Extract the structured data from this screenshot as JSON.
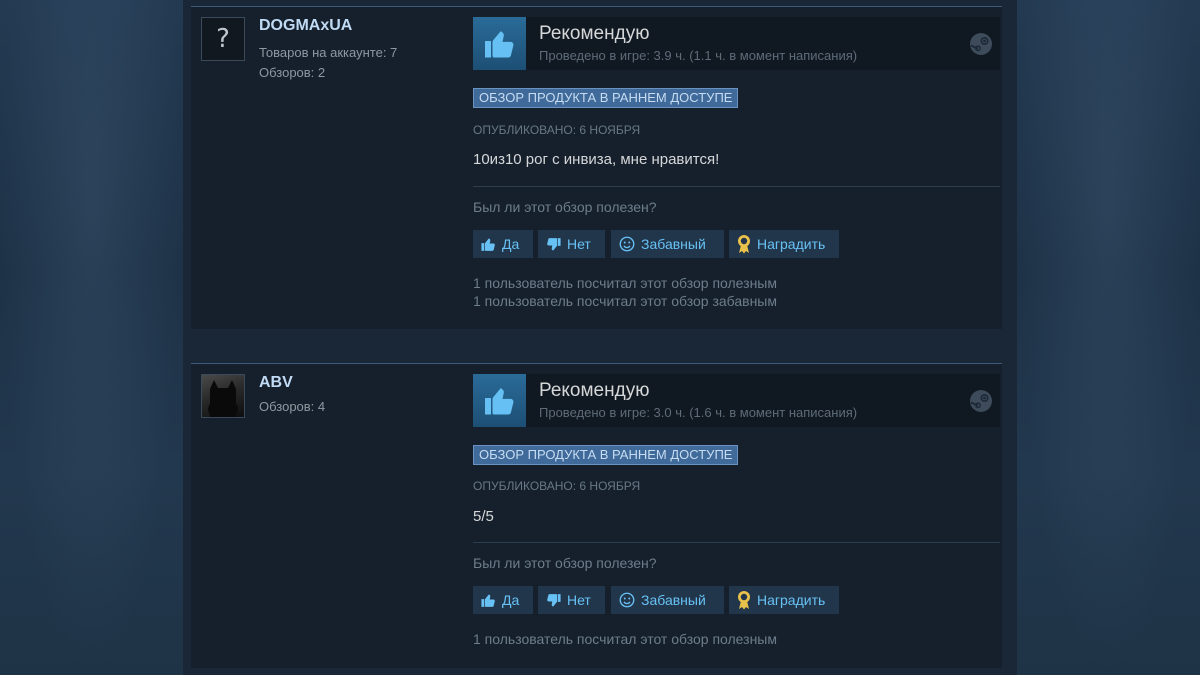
{
  "colors": {
    "page_bg": "#1b2838",
    "card_bg": "#16202d",
    "accent_link": "#67c1f5",
    "author_name": "#c1dbf4",
    "badge_bg": "#3f6a99",
    "thumb_bg": "#2a6b98"
  },
  "reviews": [
    {
      "author": {
        "name": "DOGMAxUA",
        "avatar": "question-mark-avatar",
        "products_line": "Товаров на аккаунте: 7",
        "reviews_line": "Обзоров: 2"
      },
      "verdict": "Рекомендую",
      "verdict_icon": "thumbs-up-icon",
      "hours": "Проведено в игре: 3.9 ч. (1.1 ч. в момент написания)",
      "early_access_badge": "ОБЗОР ПРОДУКТА В РАННЕМ ДОСТУПЕ",
      "posted": "ОПУБЛИКОВАНО: 6 НОЯБРЯ",
      "text": "10из10 рог с инвиза, мне нравится!",
      "helpful_question": "Был ли этот обзор полезен?",
      "buttons": {
        "yes": "Да",
        "no": "Нет",
        "funny": "Забавный",
        "award": "Наградить"
      },
      "stats": [
        "1 пользователь посчитал этот обзор полезным",
        "1 пользователь посчитал этот обзор забавным"
      ]
    },
    {
      "author": {
        "name": "ABV",
        "avatar": "cat-avatar",
        "reviews_line": "Обзоров: 4"
      },
      "verdict": "Рекомендую",
      "verdict_icon": "thumbs-up-icon",
      "hours": "Проведено в игре: 3.0 ч. (1.6 ч. в момент написания)",
      "early_access_badge": "ОБЗОР ПРОДУКТА В РАННЕМ ДОСТУПЕ",
      "posted": "ОПУБЛИКОВАНО: 6 НОЯБРЯ",
      "text": "5/5",
      "helpful_question": "Был ли этот обзор полезен?",
      "buttons": {
        "yes": "Да",
        "no": "Нет",
        "funny": "Забавный",
        "award": "Наградить"
      },
      "stats": [
        "1 пользователь посчитал этот обзор полезным"
      ]
    }
  ]
}
